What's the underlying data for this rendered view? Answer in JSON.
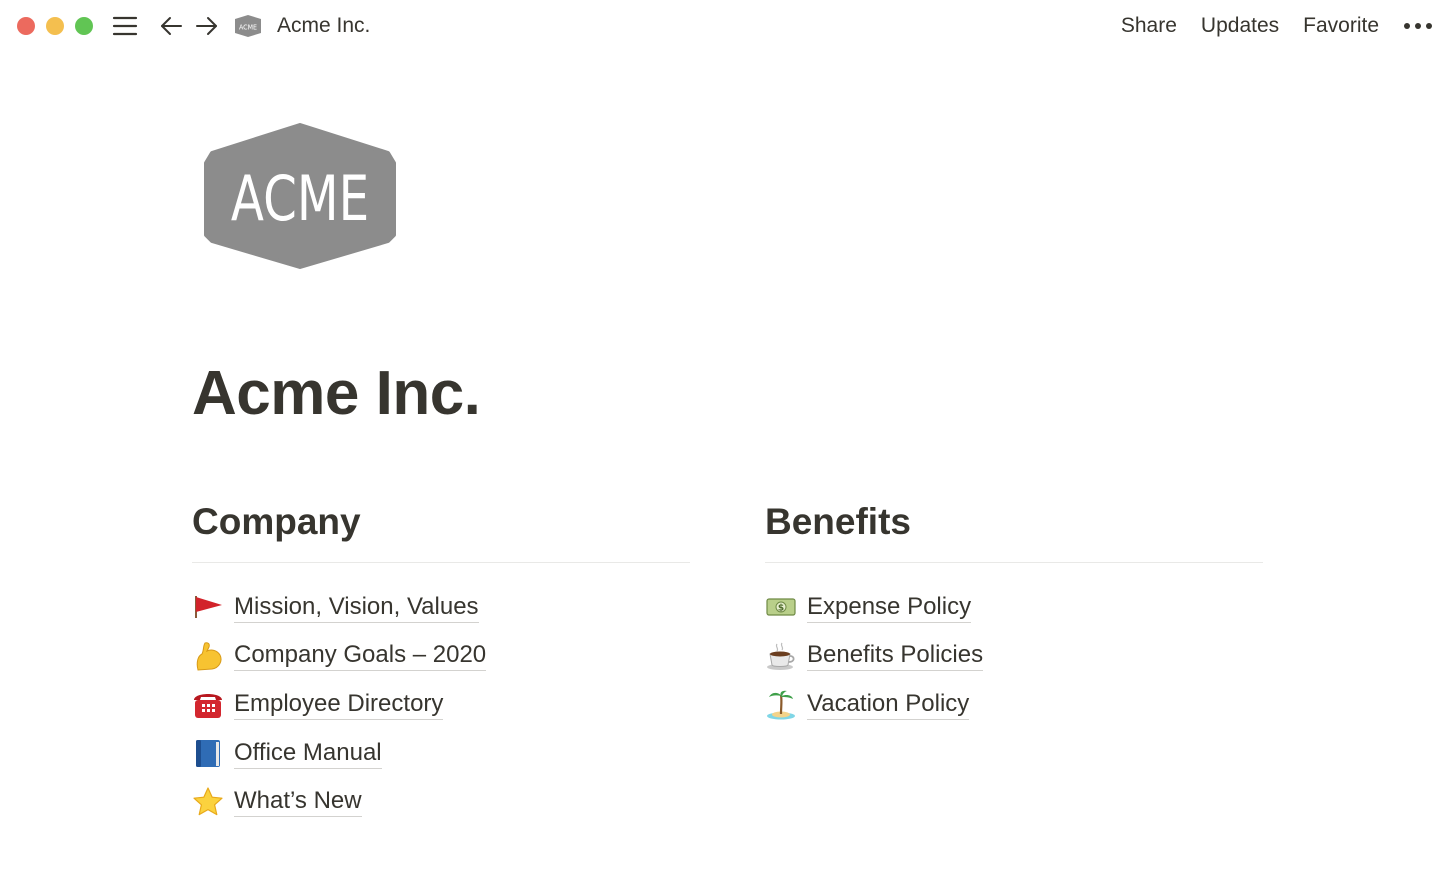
{
  "topbar": {
    "breadcrumb": "Acme Inc.",
    "actions": {
      "share": "Share",
      "updates": "Updates",
      "favorite": "Favorite"
    }
  },
  "page": {
    "logo_text": "ACME",
    "title": "Acme Inc."
  },
  "company": {
    "heading": "Company",
    "items": [
      {
        "icon": "red-flag-icon",
        "label": "Mission, Vision, Values"
      },
      {
        "icon": "flexed-biceps-icon",
        "label": "Company Goals – 2020"
      },
      {
        "icon": "telephone-icon",
        "label": "Employee Directory"
      },
      {
        "icon": "blue-book-icon",
        "label": "Office Manual"
      },
      {
        "icon": "star-icon",
        "label": "What’s New"
      }
    ]
  },
  "benefits": {
    "heading": "Benefits",
    "items": [
      {
        "icon": "dollar-banknote-icon",
        "label": "Expense Policy"
      },
      {
        "icon": "hot-beverage-icon",
        "label": "Benefits Policies"
      },
      {
        "icon": "desert-island-icon",
        "label": "Vacation Policy"
      }
    ]
  },
  "colors": {
    "text": "#37352f",
    "traffic_red": "#ec6a5e",
    "traffic_yellow": "#f4bf4f",
    "traffic_green": "#61c554",
    "logo_gray": "#8c8c8c"
  }
}
